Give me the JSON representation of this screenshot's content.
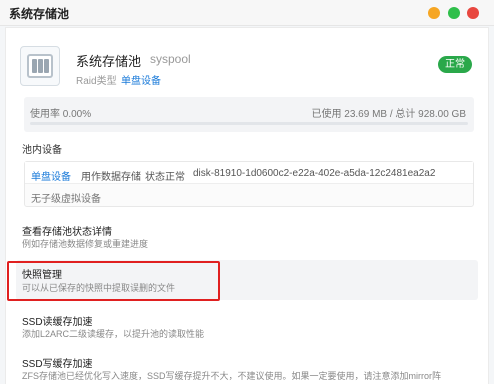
{
  "window": {
    "title": "系统存储池"
  },
  "pool": {
    "name": "系统存储池",
    "id": "syspool",
    "raid_label": "Raid类型",
    "raid_value": "单盘设备",
    "status": "正常",
    "icon": "storage-pool-icon"
  },
  "usage": {
    "label": "使用率 0.00%",
    "value": "已使用 23.69 MB / 总计 928.00 GB",
    "percent": 0
  },
  "devices": {
    "section_title": "池内设备",
    "items": [
      {
        "type": "单盘设备",
        "usage": "用作数据存储",
        "state": "状态正常",
        "disk": "disk-81910-1d0600c2-e22a-402e-a5da-12c2481ea2a2"
      }
    ],
    "no_vdev": "无子级虚拟设备"
  },
  "options": [
    {
      "title": "查看存储池状态详情",
      "desc": "例如存储池数据修复或重建进度"
    },
    {
      "title": "快照管理",
      "desc": "可以从已保存的快照中提取误删的文件"
    },
    {
      "title": "SSD读缓存加速",
      "desc": "添加L2ARC二级读缓存，以提升池的读取性能"
    },
    {
      "title": "SSD写缓存加速",
      "desc": "ZFS存储池已经优化写入速度，SSD写缓存提升不大，不建议使用。如果一定要使用，请注意添加mirror阵"
    }
  ],
  "colors": {
    "accent": "#1a7ad9",
    "status_ok": "#2aa84a",
    "highlight": "#e02020",
    "btn_min": "#f6a623",
    "btn_max": "#2fbf4a",
    "btn_close": "#e8473f"
  }
}
